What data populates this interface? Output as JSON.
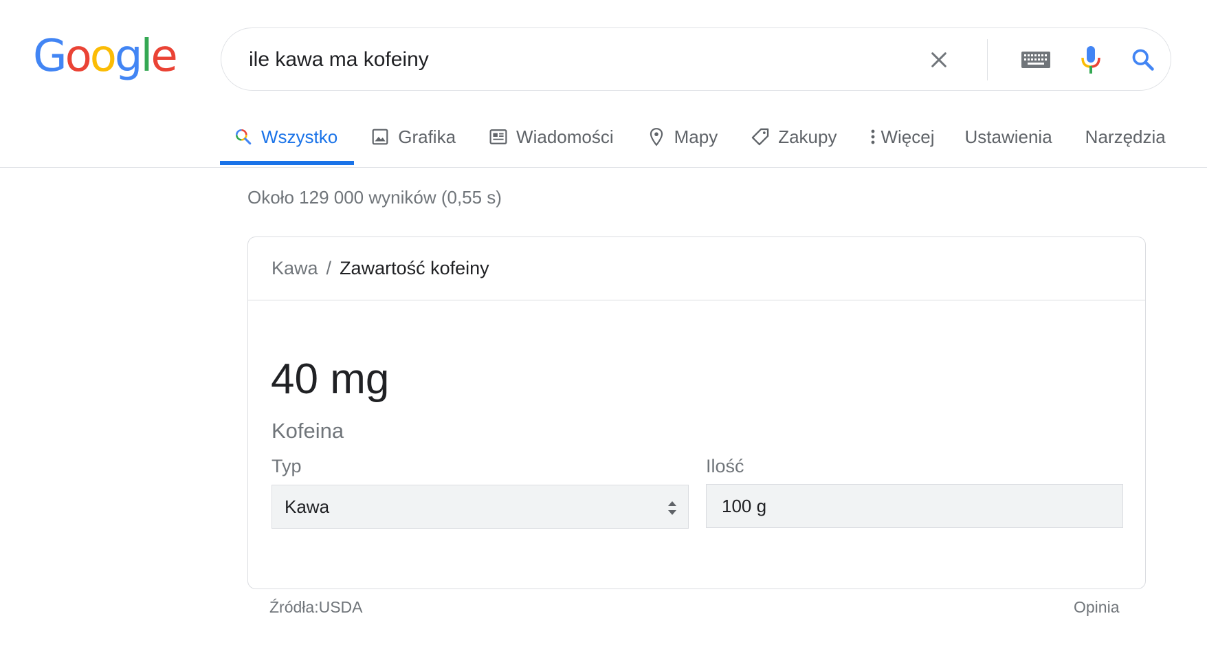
{
  "logo": {
    "letters": [
      "G",
      "o",
      "o",
      "g",
      "l",
      "e"
    ],
    "colors": [
      "#4285F4",
      "#EA4335",
      "#FBBC05",
      "#4285F4",
      "#34A853",
      "#EA4335"
    ]
  },
  "search": {
    "query": "ile kawa ma kofeiny",
    "icons": [
      "close-icon",
      "keyboard-icon",
      "microphone-icon",
      "search-icon"
    ]
  },
  "tabs": [
    {
      "label": "Wszystko",
      "icon": "search-icon",
      "active": true
    },
    {
      "label": "Grafika",
      "icon": "image-icon"
    },
    {
      "label": "Wiadomości",
      "icon": "news-icon"
    },
    {
      "label": "Mapy",
      "icon": "map-pin-icon"
    },
    {
      "label": "Zakupy",
      "icon": "tag-icon"
    },
    {
      "label": "Więcej",
      "icon": "more-vert-icon"
    },
    {
      "label": "Ustawienia"
    },
    {
      "label": "Narzędzia"
    }
  ],
  "result_stats": "Około 129 000 wyników (0,55 s)",
  "card": {
    "breadcrumb": {
      "parent": "Kawa",
      "separator": "/",
      "current": "Zawartość kofeiny"
    },
    "value": "40 mg",
    "value_label": "Kofeina",
    "type_label": "Typ",
    "type_value": "Kawa",
    "quantity_label": "Ilość",
    "quantity_value": "100 g"
  },
  "footer": {
    "source": "Źródła:USDA",
    "feedback": "Opinia"
  },
  "colors": {
    "accent": "#1a73e8",
    "text_secondary": "#70757a",
    "border": "#dadce0"
  }
}
